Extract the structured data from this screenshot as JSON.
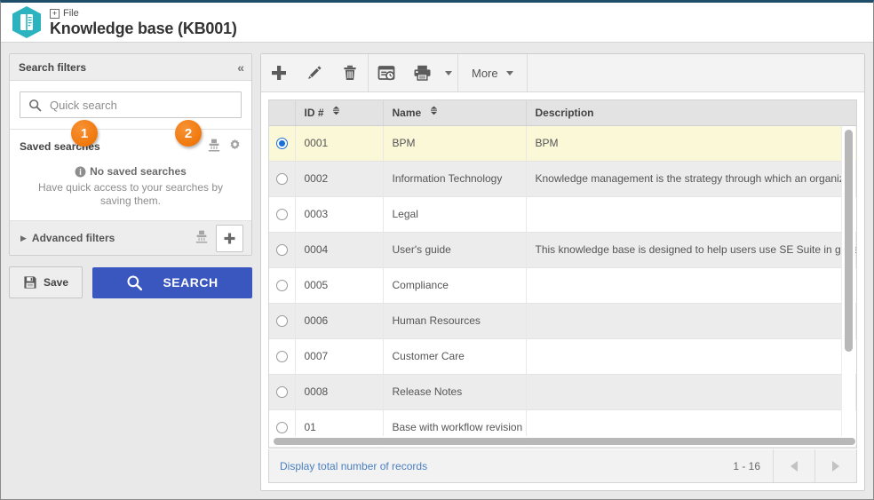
{
  "header": {
    "breadcrumb": "File",
    "title": "Knowledge base (KB001)",
    "logo_icon": "knowledge-base-book-icon",
    "expand_icon": "plus-box-icon",
    "accent": "#2bb3c0"
  },
  "sidebar": {
    "panel_title": "Search filters",
    "collapse_icon": "double-chevron-left-icon",
    "quick_search": {
      "icon": "search-icon",
      "placeholder": "Quick search",
      "value": ""
    },
    "saved_searches": {
      "title": "Saved searches",
      "clear_icon": "clear-filter-icon",
      "config_icon": "gear-icon",
      "empty_icon": "info-icon",
      "empty_title": "No saved searches",
      "empty_desc": "Have quick access to your searches by saving them."
    },
    "advanced_filters": {
      "caret_icon": "caret-right-icon",
      "label": "Advanced filters",
      "clear_icon": "clear-filter-icon",
      "add_icon": "plus-icon"
    },
    "save_button": {
      "icon": "floppy-disk-icon",
      "label": "Save"
    },
    "search_button": {
      "icon": "search-icon",
      "label": "SEARCH",
      "color": "#3a57bf"
    }
  },
  "toolbar": {
    "buttons": [
      {
        "name": "add-button",
        "icon": "plus-icon",
        "label": ""
      },
      {
        "name": "edit-button",
        "icon": "pencil-icon",
        "label": ""
      },
      {
        "name": "delete-button",
        "icon": "trash-icon",
        "label": ""
      },
      {
        "name": "history-button",
        "icon": "window-clock-icon",
        "label": ""
      },
      {
        "name": "print-button",
        "icon": "printer-icon",
        "label": ""
      }
    ],
    "more_label": "More"
  },
  "grid": {
    "columns": [
      {
        "key": "select",
        "label": ""
      },
      {
        "key": "id",
        "label": "ID #",
        "sortable": true
      },
      {
        "key": "name",
        "label": "Name",
        "sortable": true
      },
      {
        "key": "description",
        "label": "Description",
        "sortable": false
      }
    ],
    "rows": [
      {
        "id": "0001",
        "name": "BPM",
        "description": "BPM",
        "selected": true
      },
      {
        "id": "0002",
        "name": "Information Technology",
        "description": "Knowledge management is the strategy through which an organizati",
        "selected": false
      },
      {
        "id": "0003",
        "name": "Legal",
        "description": "",
        "selected": false
      },
      {
        "id": "0004",
        "name": "User's guide",
        "description": "This knowledge base is designed to help users use SE Suite in gene",
        "selected": false
      },
      {
        "id": "0005",
        "name": "Compliance",
        "description": "",
        "selected": false
      },
      {
        "id": "0006",
        "name": "Human Resources",
        "description": "",
        "selected": false
      },
      {
        "id": "0007",
        "name": "Customer Care",
        "description": "",
        "selected": false
      },
      {
        "id": "0008",
        "name": "Release Notes",
        "description": "",
        "selected": false
      },
      {
        "id": "01",
        "name": "Base with workflow revision",
        "description": "",
        "selected": false
      }
    ]
  },
  "callouts": [
    {
      "number": "1",
      "color": "#f0780c"
    },
    {
      "number": "2",
      "color": "#f0780c"
    }
  ],
  "footer": {
    "total_records_link": "Display total number of records",
    "range": "1 - 16",
    "prev_icon": "triangle-left-icon",
    "next_icon": "triangle-right-icon"
  }
}
